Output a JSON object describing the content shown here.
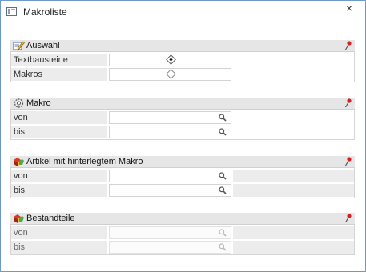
{
  "window": {
    "title": "Makroliste",
    "close_glyph": "×",
    "app_icon": "list-window-icon"
  },
  "sections": {
    "auswahl": {
      "title": "Auswahl",
      "icon": "edit-pencil-icon",
      "rows": [
        {
          "label": "Textbausteine",
          "type": "radio",
          "checked": true
        },
        {
          "label": "Makros",
          "type": "radio",
          "checked": false
        }
      ]
    },
    "makro": {
      "title": "Makro",
      "icon": "gear-icon",
      "rows": [
        {
          "label": "von",
          "value": ""
        },
        {
          "label": "bis",
          "value": ""
        }
      ]
    },
    "artikel": {
      "title": "Artikel mit hinterlegtem Makro",
      "icon": "articles-icon",
      "rows": [
        {
          "label": "von",
          "value": ""
        },
        {
          "label": "bis",
          "value": ""
        }
      ]
    },
    "bestandteile": {
      "title": "Bestandteile",
      "icon": "articles-icon",
      "disabled": true,
      "rows": [
        {
          "label": "von",
          "value": ""
        },
        {
          "label": "bis",
          "value": ""
        }
      ]
    }
  },
  "colors": {
    "accent_border": "#6d9bc9",
    "pin_red": "#d42020",
    "header_gray": "#e6e6e6"
  }
}
